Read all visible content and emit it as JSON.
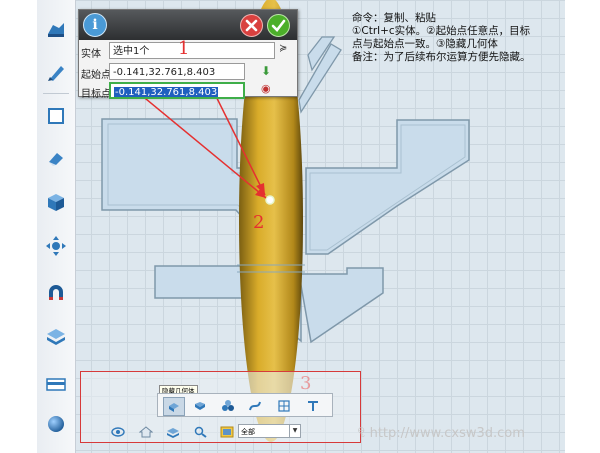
{
  "panel": {
    "info_icon": "i",
    "entity_label": "实体",
    "entity_value": "选中1个",
    "start_label": "起始点",
    "start_value": "-0.141,32.761,8.403",
    "target_label": "目标点",
    "target_value": "-0.141,32.761,8.403"
  },
  "note": {
    "line1": "命令：复制、粘贴",
    "line2": "①Ctrl+c实体。②起始点任意点，目标",
    "line3": "点与起始点一致。③隐藏几何体",
    "line4": "备注：为了后续布尔运算方便先隐藏。"
  },
  "annotations": {
    "one": "1",
    "two": "2",
    "three": "3"
  },
  "bottom_panel": {
    "tooltip": "隐藏几何体",
    "filter_value": "全部"
  },
  "toolbar_icons": [
    "sketch-icon",
    "pen-icon",
    "square-icon",
    "eraser-icon",
    "cube-icon",
    "move-icon",
    "magnet-icon",
    "layers-icon",
    "panel-icon",
    "sphere-icon"
  ],
  "watermark": "http://www.cxsw3d.com",
  "colors": {
    "accent_red": "#e53030",
    "ok_green": "#4caf2a",
    "cancel_red": "#d9413f",
    "body_yellow": "#d9ac2a",
    "wing_blue": "#c9dceb"
  }
}
